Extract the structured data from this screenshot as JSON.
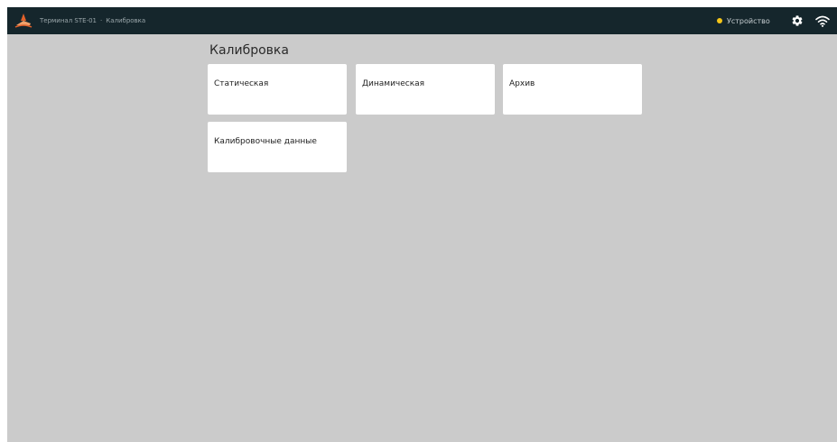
{
  "header": {
    "breadcrumb": [
      "Терминал STE-01",
      "Калибровка"
    ],
    "breadcrumb_separator": "·",
    "device_label": "Устройство",
    "device_status_color": "#f5c518",
    "logo_icon": "rower-logo-icon",
    "settings_icon": "gear-icon",
    "wifi_icon": "wifi-icon"
  },
  "main": {
    "title": "Калибровка",
    "cards": [
      {
        "label": "Статическая"
      },
      {
        "label": "Динамическая"
      },
      {
        "label": "Архив"
      },
      {
        "label": "Калибровочные данные"
      }
    ]
  },
  "colors": {
    "topbar": "#15262c",
    "background": "#cbcbcb",
    "card": "#ffffff",
    "logo_accent": "#e2612a"
  }
}
